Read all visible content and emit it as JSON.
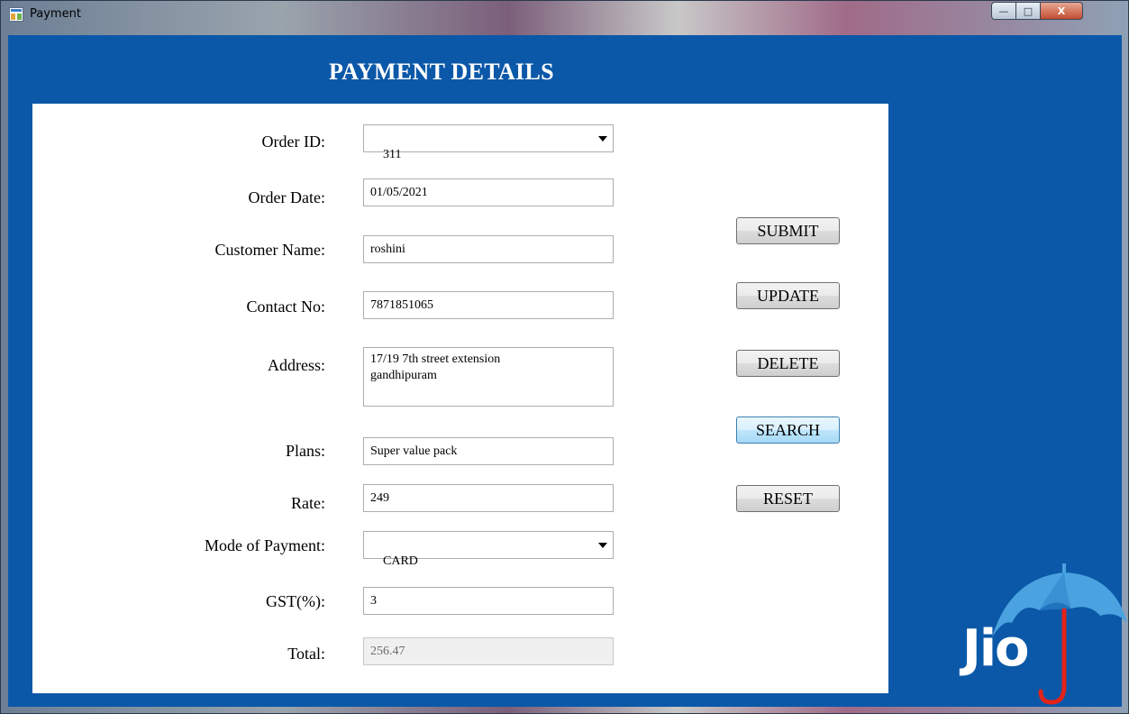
{
  "window": {
    "title": "Payment",
    "controls": {
      "minimize": "—",
      "maximize": "□",
      "close": "X"
    }
  },
  "heading": "PAYMENT DETAILS",
  "form": {
    "order_id": {
      "label": "Order ID:",
      "value": "311"
    },
    "order_date": {
      "label": "Order Date:",
      "value": "01/05/2021"
    },
    "customer_name": {
      "label": "Customer Name:",
      "value": "roshini"
    },
    "contact_no": {
      "label": "Contact No:",
      "value": "7871851065"
    },
    "address": {
      "label": "Address:",
      "value": "17/19 7th street extension\ngandhipuram"
    },
    "plans": {
      "label": "Plans:",
      "value": "Super value pack"
    },
    "rate": {
      "label": "Rate:",
      "value": "249"
    },
    "mode_of_payment": {
      "label": "Mode of Payment:",
      "value": "CARD"
    },
    "gst": {
      "label": "GST(%):",
      "value": "3"
    },
    "total": {
      "label": "Total:",
      "value": "256.47"
    }
  },
  "buttons": {
    "submit": "SUBMIT",
    "update": "UPDATE",
    "delete": "DELETE",
    "search": "SEARCH",
    "reset": "RESET"
  },
  "logo": {
    "text": "Jio",
    "icon": "umbrella-icon"
  },
  "colors": {
    "panel_bg": "#0b58a8",
    "form_bg": "#ffffff",
    "logo_umbrella": "#4aa3e0",
    "logo_handle": "#e2231a"
  }
}
